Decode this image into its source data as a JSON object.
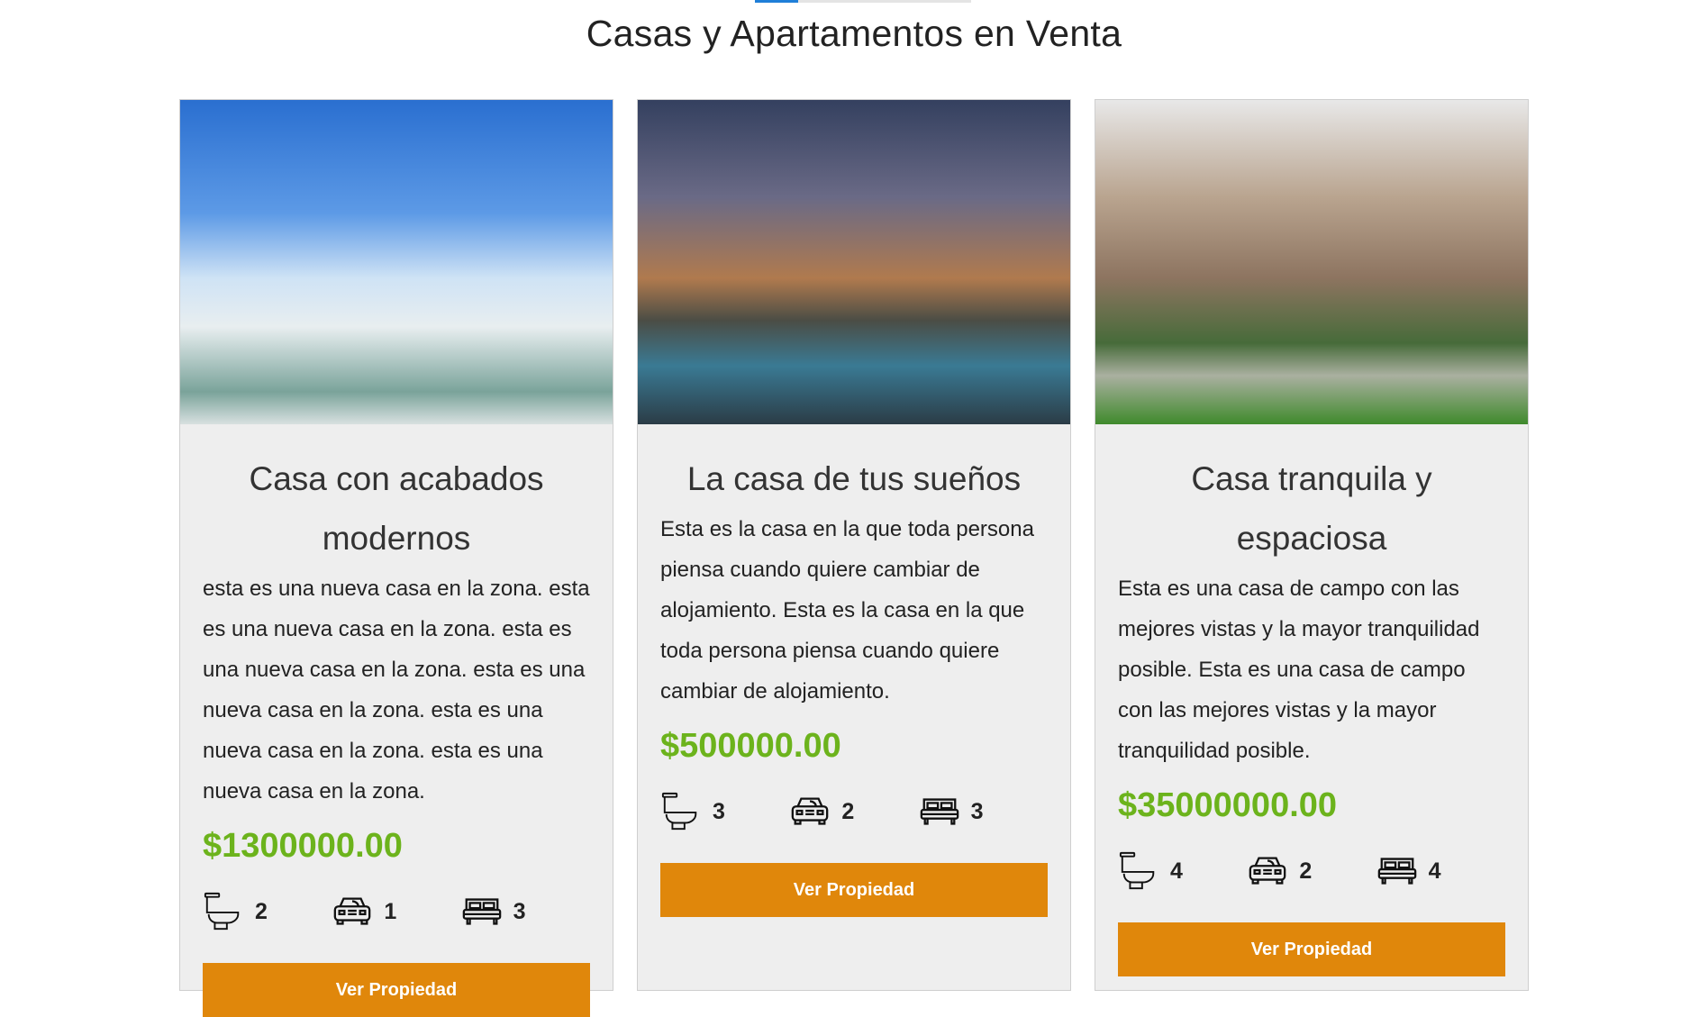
{
  "heading": "Casas y Apartamentos en Venta",
  "button_label": "Ver Propiedad",
  "colors": {
    "price": "#6cb31c",
    "button": "#e0870b",
    "card_bg": "#eeeeee"
  },
  "cards": [
    {
      "title": "Casa con acabados modernos",
      "description": "esta es una nueva casa en la zona. esta es una nueva casa en la zona. esta es una nueva casa en la zona. esta es una nueva casa en la zona. esta es una nueva casa en la zona. esta es una nueva casa en la zona.",
      "price": "$1300000.00",
      "bathrooms": "2",
      "parking": "1",
      "bedrooms": "3"
    },
    {
      "title": "La casa de tus sueños",
      "description": "Esta es la casa en la que toda persona piensa cuando quiere cambiar de alojamiento. Esta es la casa en la que toda persona piensa cuando quiere cambiar de alojamiento.",
      "price": "$500000.00",
      "bathrooms": "3",
      "parking": "2",
      "bedrooms": "3"
    },
    {
      "title": "Casa tranquila y espaciosa",
      "description": "Esta es una casa de campo con las mejores vistas y la mayor tranquilidad posible. Esta es una casa de campo con las mejores vistas y la mayor tranquilidad posible.",
      "price": "$35000000.00",
      "bathrooms": "4",
      "parking": "2",
      "bedrooms": "4"
    }
  ]
}
